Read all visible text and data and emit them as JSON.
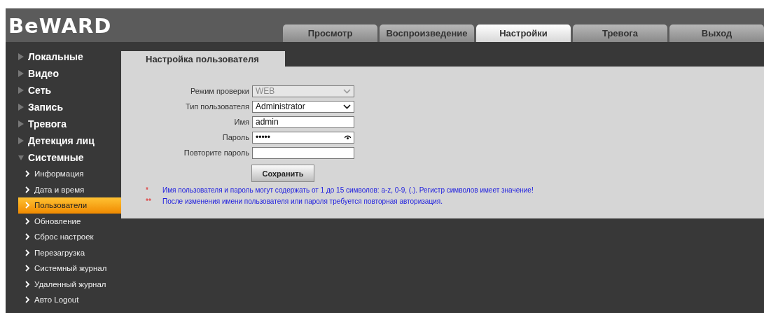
{
  "logo": "BeWARD",
  "tabs": [
    {
      "label": "Просмотр",
      "selected": false
    },
    {
      "label": "Воспроизведение",
      "selected": false
    },
    {
      "label": "Настройки",
      "selected": true
    },
    {
      "label": "Тревога",
      "selected": false
    },
    {
      "label": "Выход",
      "selected": false
    }
  ],
  "sidebar": {
    "items": [
      {
        "label": "Локальные",
        "expanded": false
      },
      {
        "label": "Видео",
        "expanded": false
      },
      {
        "label": "Сеть",
        "expanded": false
      },
      {
        "label": "Запись",
        "expanded": false
      },
      {
        "label": "Тревога",
        "expanded": false
      },
      {
        "label": "Детекция лиц",
        "expanded": false
      },
      {
        "label": "Системные",
        "expanded": true,
        "children": [
          {
            "label": "Информация",
            "selected": false
          },
          {
            "label": "Дата и время",
            "selected": false
          },
          {
            "label": "Пользователи",
            "selected": true
          },
          {
            "label": "Обновление",
            "selected": false
          },
          {
            "label": "Сброс настроек",
            "selected": false
          },
          {
            "label": "Перезагрузка",
            "selected": false
          },
          {
            "label": "Системный журнал",
            "selected": false
          },
          {
            "label": "Удаленный журнал",
            "selected": false
          },
          {
            "label": "Авто Logout",
            "selected": false
          }
        ]
      }
    ]
  },
  "panel": {
    "title": "Настройка пользователя",
    "fields": [
      {
        "kind": "select",
        "label": "Режим проверки",
        "value": "WEB",
        "disabled": true
      },
      {
        "kind": "select",
        "label": "Тип пользователя",
        "value": "Administrator",
        "disabled": false
      },
      {
        "kind": "text",
        "label": "Имя",
        "value": "admin",
        "disabled": false
      },
      {
        "kind": "password",
        "label": "Пароль",
        "value": "•••••",
        "disabled": false
      },
      {
        "kind": "text",
        "label": "Повторите пароль",
        "disabled": false
      }
    ],
    "save_button": "Сохранить",
    "notes": [
      {
        "mark": "*",
        "text": "Имя пользователя и пароль могут содержать от 1 до 15 символов: a-z, 0-9, (.). Регистр символов имеет значение!"
      },
      {
        "mark": "**",
        "text": "После изменения имени пользователя или пароля требуется повторная авторизация."
      }
    ]
  }
}
